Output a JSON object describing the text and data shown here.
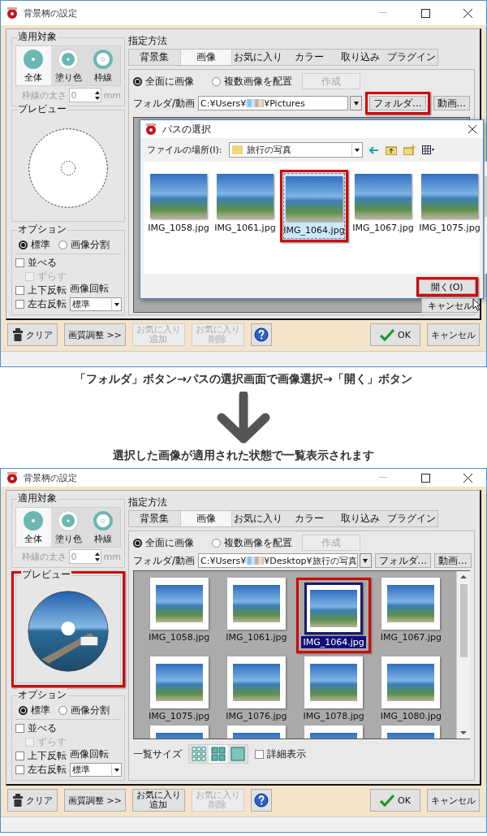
{
  "panels": [
    {
      "kind": "dialog",
      "title": "背景柄の設定",
      "target": {
        "label": "適用対象",
        "items": [
          {
            "label": "全体",
            "kind": "whole",
            "selected": true
          },
          {
            "label": "塗り色",
            "kind": "fill",
            "selected": false
          },
          {
            "label": "枠線",
            "kind": "outline",
            "selected": false
          }
        ],
        "border_width": {
          "label": "枠線の太さ",
          "value": "0",
          "unit": "mm",
          "disabled": true
        }
      },
      "preview": {
        "label": "プレビュー",
        "kind": "outline",
        "highlighted": false
      },
      "options": {
        "label": "オプション",
        "modes": [
          {
            "label": "標準",
            "selected": true
          },
          {
            "label": "画像分割",
            "selected": false
          }
        ],
        "checks": [
          {
            "label": "並べる",
            "checked": false,
            "disabled": false,
            "children": [
              {
                "label": "ずらす",
                "checked": false,
                "disabled": true
              }
            ]
          },
          {
            "label": "上下反転",
            "checked": false,
            "disabled": false
          },
          {
            "label": "左右反転",
            "checked": false,
            "disabled": false
          }
        ],
        "rotation": {
          "label": "画像回転",
          "value": "標準"
        }
      },
      "method": {
        "label": "指定方法",
        "tabs": [
          {
            "label": "背景集",
            "selected": false
          },
          {
            "label": "画像",
            "selected": true
          },
          {
            "label": "お気に入り",
            "selected": false
          },
          {
            "label": "カラー",
            "selected": false
          },
          {
            "label": "取り込み",
            "selected": false
          },
          {
            "label": "プラグイン",
            "selected": false
          }
        ],
        "modes": [
          {
            "label": "全面に画像",
            "selected": true
          },
          {
            "label": "複数画像を配置",
            "selected": false
          }
        ],
        "create_button": {
          "label": "作成",
          "disabled": true
        },
        "folder": {
          "label": "フォルダ/動画",
          "path_start": "C:¥Users¥",
          "path_end": "¥Pictures",
          "buttons": [
            {
              "label": "フォルダ...",
              "highlighted": true
            },
            {
              "label": "動画...",
              "highlighted": false
            }
          ]
        }
      },
      "footer": [
        {
          "kind": "clear",
          "lines": [
            "クリア"
          ],
          "disabled": false
        },
        {
          "kind": "plain",
          "lines": [
            "画質調整 >>"
          ],
          "disabled": false
        },
        {
          "kind": "plain",
          "lines": [
            "お気に入り",
            "追加"
          ],
          "disabled": true
        },
        {
          "kind": "plain",
          "lines": [
            "お気に入り",
            "削除"
          ],
          "disabled": true
        },
        {
          "kind": "help",
          "disabled": false
        },
        {
          "kind": "ok",
          "lines": [
            "OK"
          ],
          "disabled": false
        },
        {
          "kind": "plain",
          "lines": [
            "キャンセル"
          ],
          "disabled": false
        }
      ],
      "file_dialog": {
        "title": "パスの選択",
        "location_label": "ファイルの場所(I):",
        "location": "旅行の写真",
        "files": [
          {
            "name": "IMG_1058.jpg",
            "selected": false,
            "highlighted": false
          },
          {
            "name": "IMG_1061.jpg",
            "selected": false,
            "highlighted": false
          },
          {
            "name": "IMG_1064.jpg",
            "selected": true,
            "highlighted": true
          },
          {
            "name": "IMG_1067.jpg",
            "selected": false,
            "highlighted": false
          },
          {
            "name": "IMG_1075.jpg",
            "selected": false,
            "highlighted": false
          }
        ],
        "buttons": [
          {
            "label": "開く(O)",
            "highlighted": true
          },
          {
            "label": "キャンセル",
            "highlighted": false
          }
        ]
      }
    },
    {
      "kind": "caption",
      "text": "「フォルダ」ボタン→パスの選択画面で画像選択→「開く」ボタン"
    },
    {
      "kind": "arrow"
    },
    {
      "kind": "caption",
      "text": "選択した画像が適用された状態で一覧表示されます"
    },
    {
      "kind": "dialog",
      "title": "背景柄の設定",
      "target": {
        "label": "適用対象",
        "items": [
          {
            "label": "全体",
            "kind": "whole",
            "selected": true
          },
          {
            "label": "塗り色",
            "kind": "fill",
            "selected": false
          },
          {
            "label": "枠線",
            "kind": "outline",
            "selected": false
          }
        ],
        "border_width": {
          "label": "枠線の太さ",
          "value": "0",
          "unit": "mm",
          "disabled": true
        }
      },
      "preview": {
        "label": "プレビュー",
        "kind": "photo",
        "highlighted": true
      },
      "options": {
        "label": "オプション",
        "modes": [
          {
            "label": "標準",
            "selected": true
          },
          {
            "label": "画像分割",
            "selected": false
          }
        ],
        "checks": [
          {
            "label": "並べる",
            "checked": false,
            "disabled": false,
            "children": [
              {
                "label": "ずらす",
                "checked": false,
                "disabled": true
              }
            ]
          },
          {
            "label": "上下反転",
            "checked": false,
            "disabled": false
          },
          {
            "label": "左右反転",
            "checked": false,
            "disabled": false
          }
        ],
        "rotation": {
          "label": "画像回転",
          "value": "標準"
        }
      },
      "method": {
        "label": "指定方法",
        "tabs": [
          {
            "label": "背景集",
            "selected": false
          },
          {
            "label": "画像",
            "selected": true
          },
          {
            "label": "お気に入り",
            "selected": false
          },
          {
            "label": "カラー",
            "selected": false
          },
          {
            "label": "取り込み",
            "selected": false
          },
          {
            "label": "プラグイン",
            "selected": false
          }
        ],
        "modes": [
          {
            "label": "全面に画像",
            "selected": true
          },
          {
            "label": "複数画像を配置",
            "selected": false
          }
        ],
        "create_button": {
          "label": "作成",
          "disabled": true
        },
        "folder": {
          "label": "フォルダ/動画",
          "path_start": "C:¥Users¥",
          "path_end": "¥Desktop¥旅行の写真",
          "buttons": [
            {
              "label": "フォルダ...",
              "highlighted": false
            },
            {
              "label": "動画...",
              "highlighted": false
            }
          ]
        },
        "gallery": {
          "items": [
            {
              "kind": "full",
              "name": "IMG_1058.jpg",
              "selected": false,
              "highlighted": false
            },
            {
              "kind": "full",
              "name": "IMG_1061.jpg",
              "selected": false,
              "highlighted": false
            },
            {
              "kind": "full",
              "name": "IMG_1064.jpg",
              "selected": true,
              "highlighted": true
            },
            {
              "kind": "full",
              "name": "IMG_1067.jpg",
              "selected": false,
              "highlighted": false
            },
            {
              "kind": "full",
              "name": "IMG_1075.jpg",
              "selected": false,
              "highlighted": false
            },
            {
              "kind": "full",
              "name": "IMG_1076.jpg",
              "selected": false,
              "highlighted": false
            },
            {
              "kind": "full",
              "name": "IMG_1078.jpg",
              "selected": false,
              "highlighted": false
            },
            {
              "kind": "full",
              "name": "IMG_1080.jpg",
              "selected": false,
              "highlighted": false
            },
            {
              "kind": "cut"
            },
            {
              "kind": "cut"
            },
            {
              "kind": "cut"
            },
            {
              "kind": "cut"
            }
          ],
          "size_label": "一覧サイズ",
          "sizes": [
            {
              "kind": "small",
              "selected": false
            },
            {
              "kind": "medium",
              "selected": true
            },
            {
              "kind": "large",
              "selected": false
            }
          ],
          "detail": {
            "label": "詳細表示",
            "checked": false
          }
        }
      },
      "footer": [
        {
          "kind": "clear",
          "lines": [
            "クリア"
          ],
          "disabled": false
        },
        {
          "kind": "plain",
          "lines": [
            "画質調整 >>"
          ],
          "disabled": false
        },
        {
          "kind": "plain",
          "lines": [
            "お気に入り",
            "追加"
          ],
          "disabled": false
        },
        {
          "kind": "plain",
          "lines": [
            "お気に入り",
            "削除"
          ],
          "disabled": true
        },
        {
          "kind": "help",
          "disabled": false
        },
        {
          "kind": "ok",
          "lines": [
            "OK"
          ],
          "disabled": false
        },
        {
          "kind": "plain",
          "lines": [
            "キャンセル"
          ],
          "disabled": false
        }
      ]
    }
  ]
}
